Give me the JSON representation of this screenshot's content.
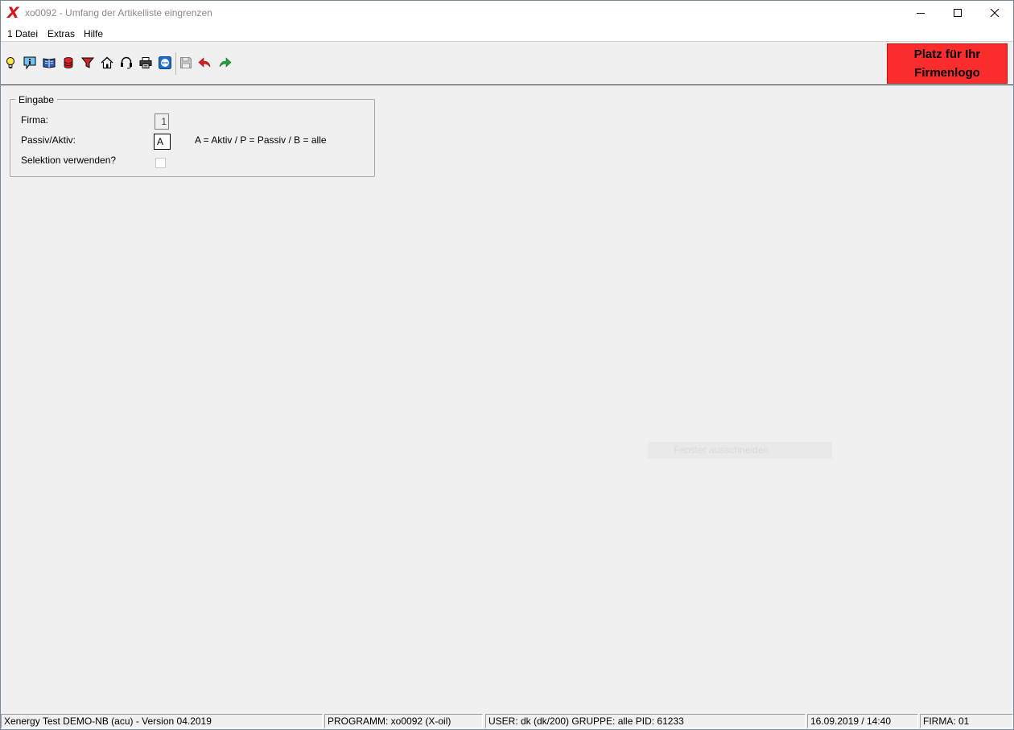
{
  "window": {
    "title": "xo0092 - Umfang der Artikelliste eingrenzen",
    "app_icon_glyph": "X",
    "controls": [
      "minimize-icon",
      "maximize-icon",
      "close-icon"
    ]
  },
  "menu": [
    {
      "label": "1 Datei"
    },
    {
      "label": "Extras"
    },
    {
      "label": "Hilfe"
    }
  ],
  "toolbar": {
    "icons": [
      "lightbulb-icon",
      "info-icon",
      "book-icon",
      "database-icon",
      "filter-icon",
      "home-icon",
      "headset-icon",
      "printer-icon",
      "teamviewer-icon",
      "save-icon",
      "undo-icon",
      "redo-icon"
    ],
    "logo_line1": "Platz für Ihr",
    "logo_line2": "Firmenlogo",
    "logo_color": "#fa2c2c"
  },
  "form": {
    "group_title": "Eingabe",
    "firma_label": "Firma:",
    "firma_value": "1",
    "passiv_label": "Passiv/Aktiv:",
    "passiv_value": "A",
    "passiv_hint": "A = Aktiv / P = Passiv / B = alle",
    "selektion_label": "Selektion verwenden?",
    "selektion_checked": false
  },
  "ghost_tooltip": "Fenster ausschneiden",
  "status": {
    "version": "Xenergy Test DEMO-NB (acu) - Version 04.2019",
    "programm": "PROGRAMM: xo0092 (X-oil)",
    "user": "USER: dk (dk/200)  GRUPPE: alle  PID: 61233",
    "datetime": "16.09.2019 / 14:40",
    "firma": "FIRMA: 01"
  }
}
